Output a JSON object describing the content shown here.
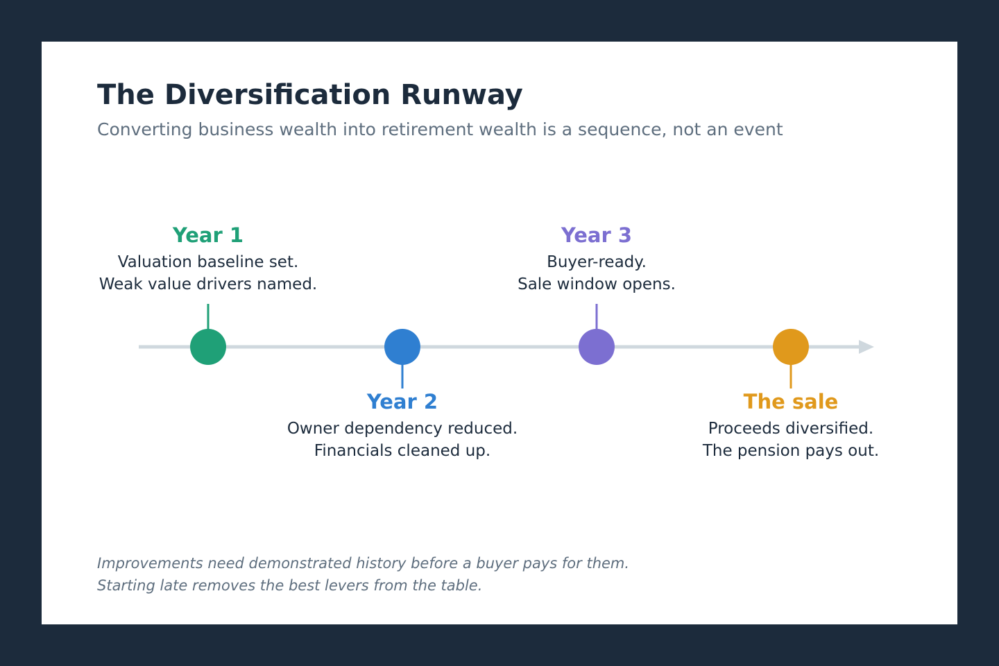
{
  "title": "The Diversification Runway",
  "subtitle": "Converting business wealth into retirement wealth is a sequence, not an event",
  "timeline": {
    "axis_color": "#cfd8de",
    "milestones": [
      {
        "title": "Year 1",
        "line1": "Valuation baseline set.",
        "line2": "Weak value drivers named.",
        "color": "#1fa077",
        "placement": "above"
      },
      {
        "title": "Year 2",
        "line1": "Owner dependency reduced.",
        "line2": "Financials cleaned up.",
        "color": "#2f7fd1",
        "placement": "below"
      },
      {
        "title": "Year 3",
        "line1": "Buyer-ready.",
        "line2": "Sale window opens.",
        "color": "#7c6fd1",
        "placement": "above"
      },
      {
        "title": "The sale",
        "line1": "Proceeds diversified.",
        "line2": "The pension pays out.",
        "color": "#e0991c",
        "placement": "below"
      }
    ]
  },
  "footnote": {
    "line1": "Improvements need demonstrated history before a buyer pays for them.",
    "line2": "Starting late removes the best levers from the table."
  }
}
